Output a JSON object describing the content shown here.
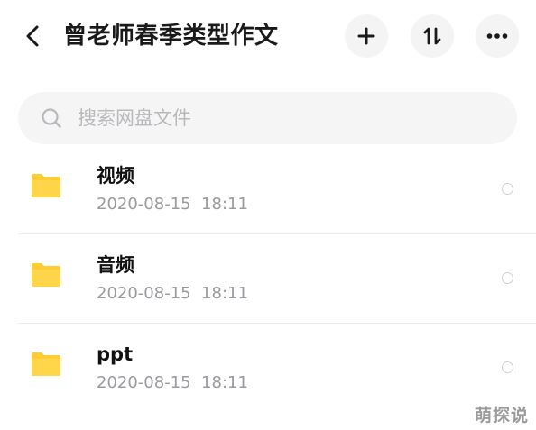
{
  "header": {
    "title": "曾老师春季类型作文",
    "back_icon": "chevron-left-icon",
    "add_icon": "plus-icon",
    "sort_icon": "sort-icon",
    "more_icon": "more-horizontal-icon"
  },
  "search": {
    "placeholder": "搜索网盘文件",
    "value": ""
  },
  "files": [
    {
      "name": "视频",
      "date": "2020-08-15  18:11"
    },
    {
      "name": "音频",
      "date": "2020-08-15  18:11"
    },
    {
      "name": "ppt",
      "date": "2020-08-15  18:11"
    }
  ],
  "watermark": "萌探说",
  "colors": {
    "folder": "#FFCC33",
    "text_primary": "#111111",
    "text_secondary": "#9A9A9F",
    "button_bg": "#F4F4F5"
  }
}
